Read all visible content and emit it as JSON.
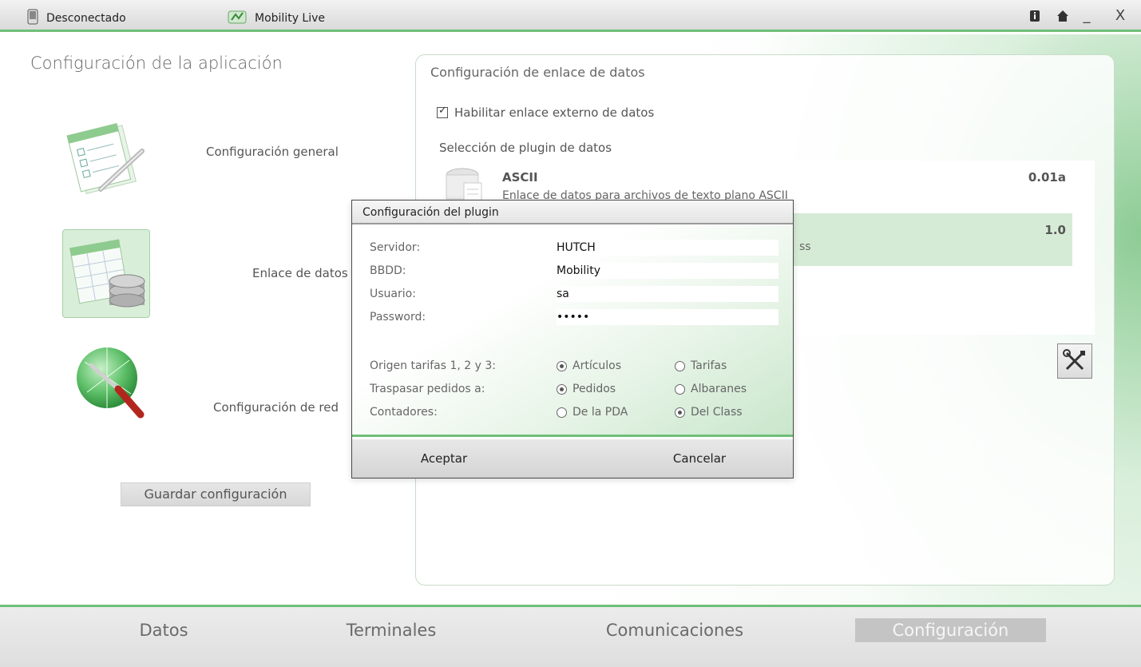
{
  "titlebar": {
    "status": "Desconectado",
    "app_name": "Mobility Live",
    "controls": {
      "minimize": "_",
      "close": "X"
    }
  },
  "main": {
    "title": "Configuración de la aplicación",
    "nav": [
      {
        "label": "Configuración general",
        "icon": "checklist-icon"
      },
      {
        "label": "Enlace de datos",
        "icon": "database-spreadsheet-icon"
      },
      {
        "label": "Configuración de red",
        "icon": "network-tools-icon"
      }
    ],
    "save_button": "Guardar configuración"
  },
  "panel": {
    "title": "Configuración de enlace de datos",
    "enable_checkbox": {
      "label": "Habilitar enlace externo de datos",
      "checked": true
    },
    "selection_label": "Selección de plugin de datos",
    "plugins": [
      {
        "name": "ASCII",
        "description": "Enlace de datos para archivos de texto plano ASCII",
        "version": "0.01a",
        "selected": false
      },
      {
        "name": "",
        "description": "ss",
        "version": "1.0",
        "selected": true
      }
    ]
  },
  "dialog": {
    "title": "Configuración del plugin",
    "fields": {
      "servidor": {
        "label": "Servidor:",
        "value": "HUTCH"
      },
      "bbdd": {
        "label": "BBDD:",
        "value": "Mobility"
      },
      "usuario": {
        "label": "Usuario:",
        "value": "sa"
      },
      "password": {
        "label": "Password:",
        "value": "•••••"
      }
    },
    "options": {
      "origen": {
        "label": "Origen tarifas 1, 2 y 3:",
        "opt1": "Artículos",
        "opt2": "Tarifas",
        "selected": 1
      },
      "traspasar": {
        "label": "Traspasar pedidos a:",
        "opt1": "Pedidos",
        "opt2": "Albaranes",
        "selected": 1
      },
      "contadores": {
        "label": "Contadores:",
        "opt1": "De la PDA",
        "opt2": "Del Class",
        "selected": 2
      }
    },
    "accept": "Aceptar",
    "cancel": "Cancelar"
  },
  "bottom_nav": {
    "tabs": [
      "Datos",
      "Terminales",
      "Comunicaciones",
      "Configuración"
    ],
    "active": "Configuración"
  },
  "colors": {
    "accent": "#6fbf78",
    "selected_row": "#d6ebd6",
    "active_tab": "#c4c4c4"
  }
}
